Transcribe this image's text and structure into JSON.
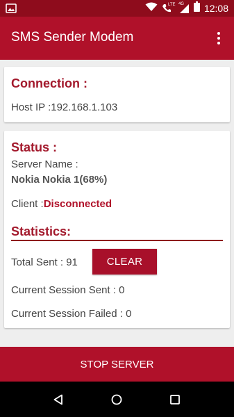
{
  "status_bar": {
    "time": "12:08",
    "lte_badge": "LTE",
    "fourg_badge": "4G",
    "icons": [
      "image-icon",
      "wifi-icon",
      "call-icon",
      "signal-icon",
      "battery-icon"
    ]
  },
  "app_bar": {
    "title": "SMS Sender Modem",
    "menu_icon": "more-vert-icon"
  },
  "connection": {
    "heading": "Connection :",
    "host_label": "Host IP :",
    "host_value": "192.168.1.103"
  },
  "status": {
    "heading": "Status :",
    "server_name_label": "Server Name :",
    "server_name_value": "Nokia Nokia 1(68%)",
    "client_label": "Client :",
    "client_value": "Disconnected"
  },
  "statistics": {
    "heading": "Statistics:",
    "total_sent": "Total Sent : 91",
    "clear_label": "CLEAR",
    "session_sent": "Current Session Sent : 0",
    "session_failed": "Current Session Failed : 0"
  },
  "footer": {
    "stop_label": "STOP SERVER"
  },
  "nav": {
    "icons": [
      "back-icon",
      "home-icon",
      "recents-icon"
    ]
  },
  "colors": {
    "primary": "#b0112a",
    "primary_dark": "#8e0c1c",
    "accent_text": "#a3192c"
  }
}
